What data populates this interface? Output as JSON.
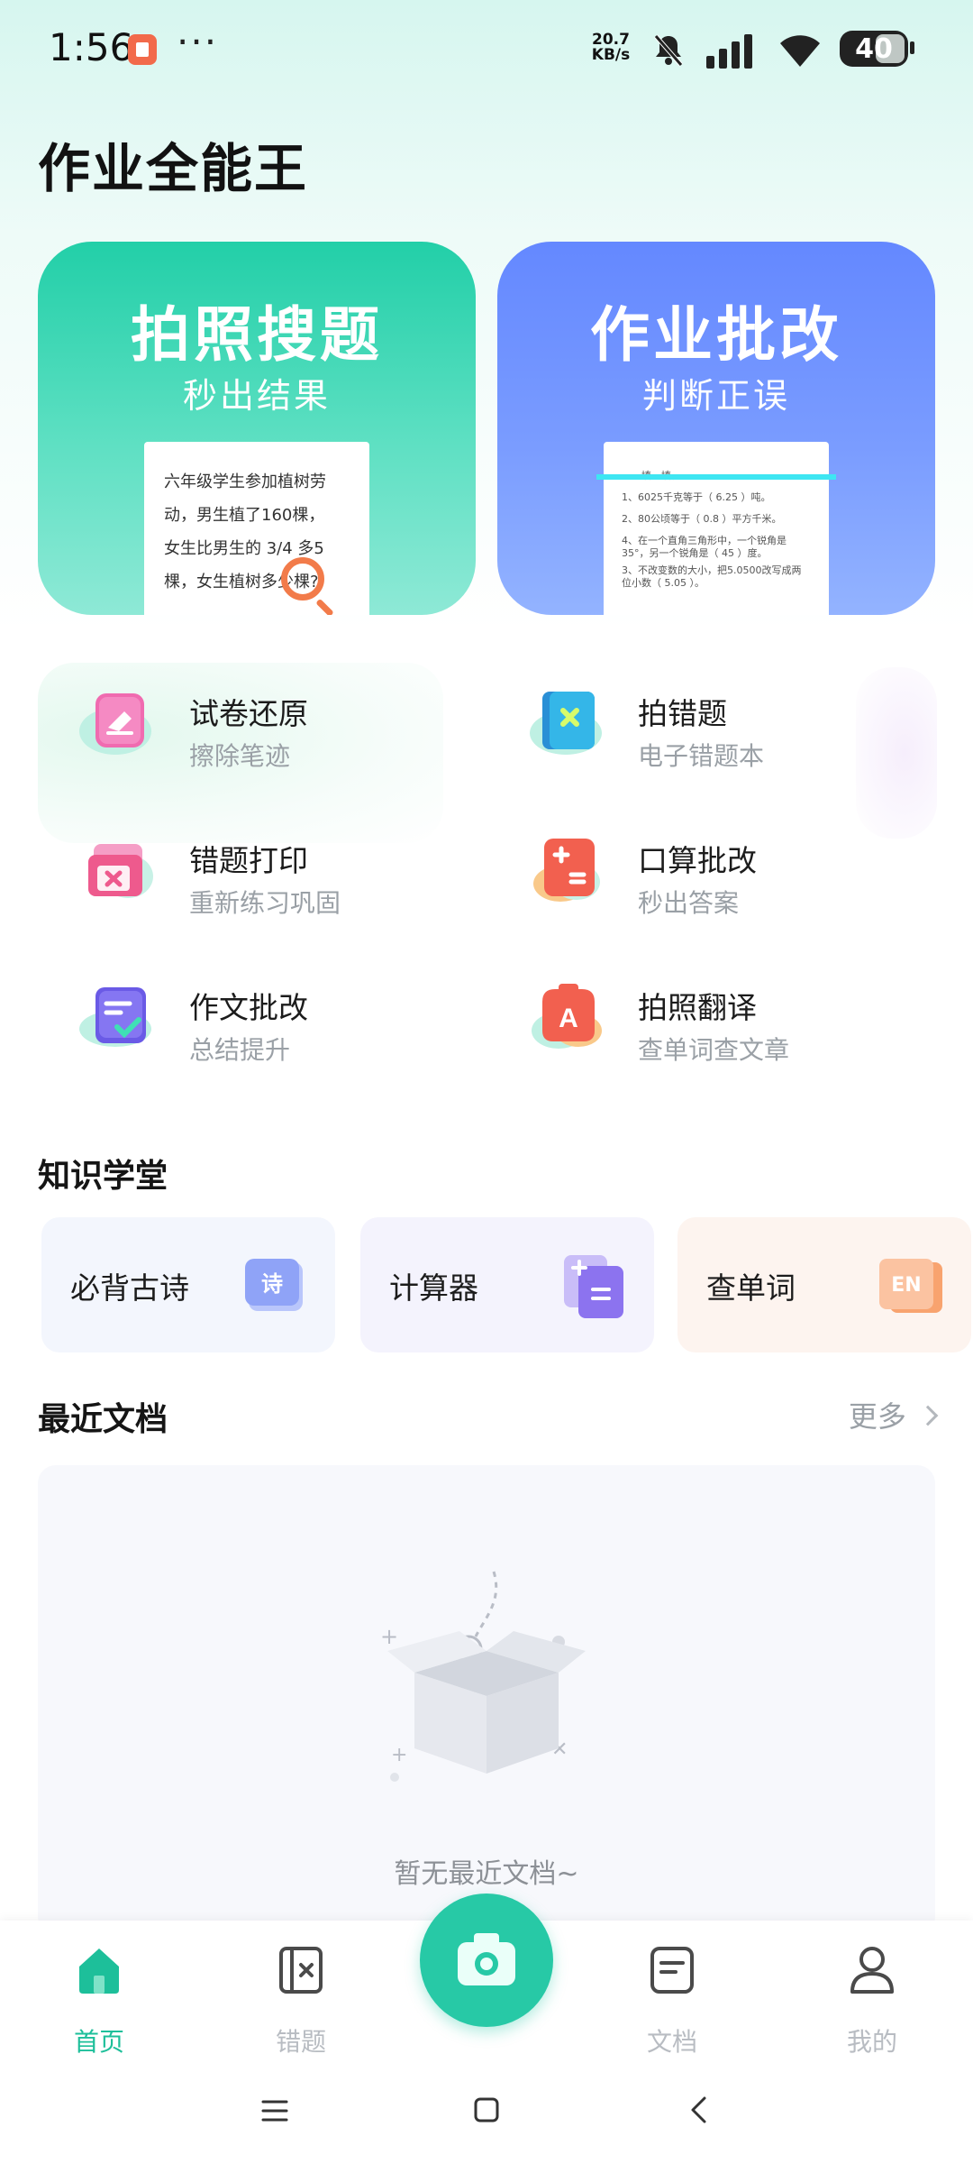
{
  "status_bar": {
    "time": "1:56",
    "dots": "···",
    "net_speed_value": "20.7",
    "net_speed_unit": "KB/s",
    "battery": "40",
    "icons": [
      "mute-bell-icon",
      "signal-icon",
      "wifi-icon",
      "battery-icon"
    ]
  },
  "app_title": "作业全能王",
  "hero": {
    "search": {
      "title": "拍照搜题",
      "subtitle": "秒出结果",
      "paper_text": "六年级学生参加植树劳动，男生植了160棵，女生比男生的3/4多5棵，女生植树多少棵?",
      "paper_lines": [
        "六年级学生参加植树劳",
        "动，男生植了160棵，",
        "女生比男生的 3/4 多5",
        "棵，女生植树多少棵?"
      ]
    },
    "correct": {
      "title": "作业批改",
      "subtitle": "判断正误",
      "paper_lines": [
        "一、填一填。",
        "1、6025千克等于（ 6.25 ）吨。",
        "2、80公顷等于（ 0.8 ）平方千米。",
        "4、在一个直角三角形中，一个锐角是35°，另一个锐角是（ 45 ）度。",
        "3、不改变数的大小，把5.0500改写成两位小数（ 5.05 ）。"
      ]
    }
  },
  "tools": [
    {
      "name": "试卷还原",
      "desc": "擦除笔迹",
      "icon": "eraser-icon"
    },
    {
      "name": "拍错题",
      "desc": "电子错题本",
      "icon": "wrong-book-icon"
    },
    {
      "name": "错题打印",
      "desc": "重新练习巩固",
      "icon": "print-icon"
    },
    {
      "name": "口算批改",
      "desc": "秒出答案",
      "icon": "calculator-icon"
    },
    {
      "name": "作文批改",
      "desc": "总结提升",
      "icon": "essay-icon"
    },
    {
      "name": "拍照翻译",
      "desc": "查单词查文章",
      "icon": "translate-icon"
    }
  ],
  "knowledge": {
    "title": "知识学堂",
    "cards": [
      {
        "label": "必背古诗",
        "icon_text": "诗",
        "icon": "poem-icon"
      },
      {
        "label": "计算器",
        "icon_text": "",
        "icon": "calculator-icon"
      },
      {
        "label": "查单词",
        "icon_text": "EN",
        "icon": "dictionary-icon"
      }
    ]
  },
  "recent": {
    "title": "最近文档",
    "more": "更多",
    "empty_text": "暂无最近文档~"
  },
  "bottom_nav": {
    "items": [
      {
        "label": "首页",
        "icon": "home-icon",
        "active": true
      },
      {
        "label": "错题",
        "icon": "wrong-questions-icon",
        "active": false
      },
      {
        "label": "文档",
        "icon": "document-icon",
        "active": false
      },
      {
        "label": "我的",
        "icon": "profile-icon",
        "active": false
      }
    ],
    "camera_icon": "camera-icon"
  },
  "colors": {
    "accent": "#27c9a6",
    "hero_search": "#22cfa8",
    "hero_correct": "#6488ff",
    "muted_text": "#9aa0a6"
  }
}
